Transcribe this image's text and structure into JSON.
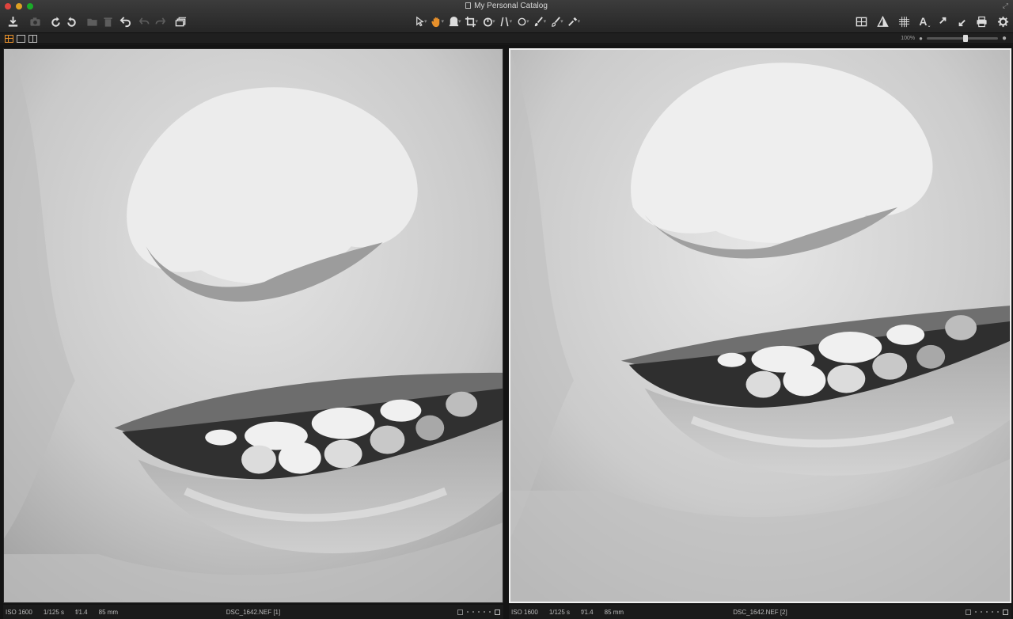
{
  "window": {
    "title": "My Personal Catalog"
  },
  "zoom": {
    "percent_label": "100%",
    "level": 0.55
  },
  "panes": [
    {
      "iso": "ISO 1600",
      "shutter": "1/125 s",
      "aperture": "f/1.4",
      "focal": "85 mm",
      "filename": "DSC_1642.NEF [1]",
      "selected": false
    },
    {
      "iso": "ISO 1600",
      "shutter": "1/125 s",
      "aperture": "f/1.4",
      "focal": "85 mm",
      "filename": "DSC_1642.NEF [2]",
      "selected": true
    }
  ],
  "colors": {
    "accent": "#e7902b",
    "selected_border": "#f0f0f0"
  },
  "toolbar": {
    "left_icons": [
      "import-icon",
      "camera-icon",
      "rotate-left-icon",
      "rotate-right-icon",
      "folder-icon",
      "trash-icon",
      "revert-icon",
      "undo-icon",
      "redo-icon",
      "stack-icon"
    ],
    "center_tools": [
      "select-tool-icon",
      "hand-tool-icon",
      "loupe-tool-icon",
      "crop-tool-icon",
      "straighten-tool-icon",
      "keystone-tool-icon",
      "spot-tool-icon",
      "brush-tool-icon",
      "eraser-tool-icon",
      "picker-tool-icon"
    ],
    "right_icons": [
      "compare-icon",
      "exposure-warning-icon",
      "grid-icon",
      "text-icon",
      "export-arrows-icon",
      "print-icon",
      "settings-gear-icon"
    ]
  }
}
